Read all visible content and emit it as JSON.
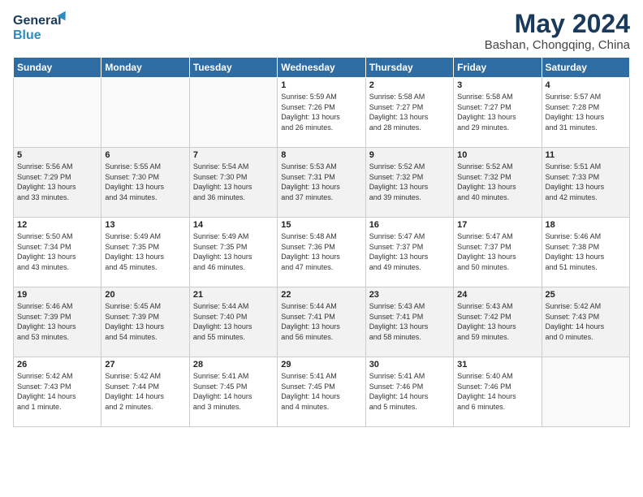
{
  "header": {
    "logo_general": "General",
    "logo_blue": "Blue",
    "title": "May 2024",
    "subtitle": "Bashan, Chongqing, China"
  },
  "weekdays": [
    "Sunday",
    "Monday",
    "Tuesday",
    "Wednesday",
    "Thursday",
    "Friday",
    "Saturday"
  ],
  "weeks": [
    [
      {
        "day": "",
        "info": ""
      },
      {
        "day": "",
        "info": ""
      },
      {
        "day": "",
        "info": ""
      },
      {
        "day": "1",
        "info": "Sunrise: 5:59 AM\nSunset: 7:26 PM\nDaylight: 13 hours\nand 26 minutes."
      },
      {
        "day": "2",
        "info": "Sunrise: 5:58 AM\nSunset: 7:27 PM\nDaylight: 13 hours\nand 28 minutes."
      },
      {
        "day": "3",
        "info": "Sunrise: 5:58 AM\nSunset: 7:27 PM\nDaylight: 13 hours\nand 29 minutes."
      },
      {
        "day": "4",
        "info": "Sunrise: 5:57 AM\nSunset: 7:28 PM\nDaylight: 13 hours\nand 31 minutes."
      }
    ],
    [
      {
        "day": "5",
        "info": "Sunrise: 5:56 AM\nSunset: 7:29 PM\nDaylight: 13 hours\nand 33 minutes."
      },
      {
        "day": "6",
        "info": "Sunrise: 5:55 AM\nSunset: 7:30 PM\nDaylight: 13 hours\nand 34 minutes."
      },
      {
        "day": "7",
        "info": "Sunrise: 5:54 AM\nSunset: 7:30 PM\nDaylight: 13 hours\nand 36 minutes."
      },
      {
        "day": "8",
        "info": "Sunrise: 5:53 AM\nSunset: 7:31 PM\nDaylight: 13 hours\nand 37 minutes."
      },
      {
        "day": "9",
        "info": "Sunrise: 5:52 AM\nSunset: 7:32 PM\nDaylight: 13 hours\nand 39 minutes."
      },
      {
        "day": "10",
        "info": "Sunrise: 5:52 AM\nSunset: 7:32 PM\nDaylight: 13 hours\nand 40 minutes."
      },
      {
        "day": "11",
        "info": "Sunrise: 5:51 AM\nSunset: 7:33 PM\nDaylight: 13 hours\nand 42 minutes."
      }
    ],
    [
      {
        "day": "12",
        "info": "Sunrise: 5:50 AM\nSunset: 7:34 PM\nDaylight: 13 hours\nand 43 minutes."
      },
      {
        "day": "13",
        "info": "Sunrise: 5:49 AM\nSunset: 7:35 PM\nDaylight: 13 hours\nand 45 minutes."
      },
      {
        "day": "14",
        "info": "Sunrise: 5:49 AM\nSunset: 7:35 PM\nDaylight: 13 hours\nand 46 minutes."
      },
      {
        "day": "15",
        "info": "Sunrise: 5:48 AM\nSunset: 7:36 PM\nDaylight: 13 hours\nand 47 minutes."
      },
      {
        "day": "16",
        "info": "Sunrise: 5:47 AM\nSunset: 7:37 PM\nDaylight: 13 hours\nand 49 minutes."
      },
      {
        "day": "17",
        "info": "Sunrise: 5:47 AM\nSunset: 7:37 PM\nDaylight: 13 hours\nand 50 minutes."
      },
      {
        "day": "18",
        "info": "Sunrise: 5:46 AM\nSunset: 7:38 PM\nDaylight: 13 hours\nand 51 minutes."
      }
    ],
    [
      {
        "day": "19",
        "info": "Sunrise: 5:46 AM\nSunset: 7:39 PM\nDaylight: 13 hours\nand 53 minutes."
      },
      {
        "day": "20",
        "info": "Sunrise: 5:45 AM\nSunset: 7:39 PM\nDaylight: 13 hours\nand 54 minutes."
      },
      {
        "day": "21",
        "info": "Sunrise: 5:44 AM\nSunset: 7:40 PM\nDaylight: 13 hours\nand 55 minutes."
      },
      {
        "day": "22",
        "info": "Sunrise: 5:44 AM\nSunset: 7:41 PM\nDaylight: 13 hours\nand 56 minutes."
      },
      {
        "day": "23",
        "info": "Sunrise: 5:43 AM\nSunset: 7:41 PM\nDaylight: 13 hours\nand 58 minutes."
      },
      {
        "day": "24",
        "info": "Sunrise: 5:43 AM\nSunset: 7:42 PM\nDaylight: 13 hours\nand 59 minutes."
      },
      {
        "day": "25",
        "info": "Sunrise: 5:42 AM\nSunset: 7:43 PM\nDaylight: 14 hours\nand 0 minutes."
      }
    ],
    [
      {
        "day": "26",
        "info": "Sunrise: 5:42 AM\nSunset: 7:43 PM\nDaylight: 14 hours\nand 1 minute."
      },
      {
        "day": "27",
        "info": "Sunrise: 5:42 AM\nSunset: 7:44 PM\nDaylight: 14 hours\nand 2 minutes."
      },
      {
        "day": "28",
        "info": "Sunrise: 5:41 AM\nSunset: 7:45 PM\nDaylight: 14 hours\nand 3 minutes."
      },
      {
        "day": "29",
        "info": "Sunrise: 5:41 AM\nSunset: 7:45 PM\nDaylight: 14 hours\nand 4 minutes."
      },
      {
        "day": "30",
        "info": "Sunrise: 5:41 AM\nSunset: 7:46 PM\nDaylight: 14 hours\nand 5 minutes."
      },
      {
        "day": "31",
        "info": "Sunrise: 5:40 AM\nSunset: 7:46 PM\nDaylight: 14 hours\nand 6 minutes."
      },
      {
        "day": "",
        "info": ""
      }
    ]
  ]
}
